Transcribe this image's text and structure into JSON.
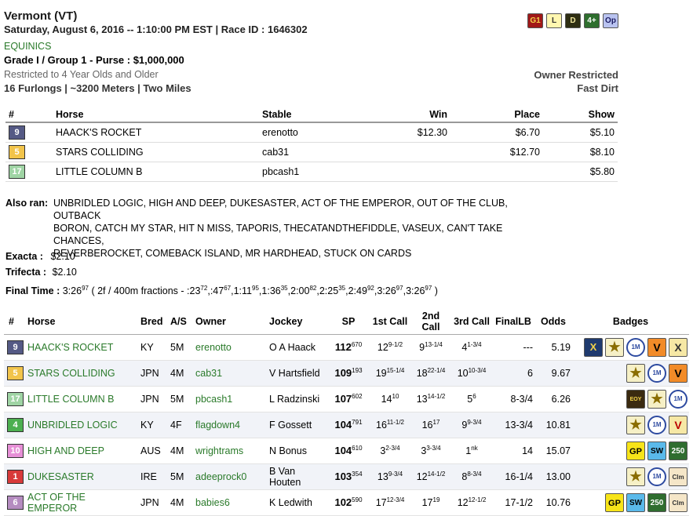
{
  "race": {
    "title": "Vermont (VT)",
    "datetime": "Saturday, August 6, 2016 -- 1:10:00 PM EST | Race ID : 1646302",
    "sponsor": "EQUINICS",
    "grade_purse": "Grade I / Group 1 - Purse : $1,000,000",
    "restriction": "Restricted to 4 Year Olds and Older",
    "distance": "16 Furlongs | ~3200 Meters | Two Miles",
    "owner_restriction": "Owner Restricted",
    "surface": "Fast Dirt",
    "top_badges": [
      {
        "label": "G1",
        "bg": "#a01818",
        "fg": "#f3d34a"
      },
      {
        "label": "L",
        "bg": "#fff7b0",
        "fg": "#333"
      },
      {
        "label": "D",
        "bg": "#2e2e12",
        "fg": "#f3e9a0"
      },
      {
        "label": "4+",
        "bg": "#2e6e2e",
        "fg": "#fff"
      },
      {
        "label": "Op",
        "bg": "#b9c3f0",
        "fg": "#1a1a60"
      }
    ]
  },
  "payout": {
    "headers": {
      "num": "#",
      "horse": "Horse",
      "stable": "Stable",
      "win": "Win",
      "place": "Place",
      "show": "Show"
    },
    "rows": [
      {
        "num": "9",
        "num_bg": "#555a85",
        "num_fg": "#fff",
        "horse": "HAACK'S ROCKET",
        "stable": "erenotto",
        "win": "$12.30",
        "place": "$6.70",
        "show": "$5.10"
      },
      {
        "num": "5",
        "num_bg": "#f2c44b",
        "num_fg": "#fff",
        "horse": "STARS COLLIDING",
        "stable": "cab31",
        "win": "",
        "place": "$12.70",
        "show": "$8.10"
      },
      {
        "num": "17",
        "num_bg": "#9fd4a4",
        "num_fg": "#fff",
        "horse": "LITTLE COLUMN B",
        "stable": "pbcash1",
        "win": "",
        "place": "",
        "show": "$5.80"
      }
    ]
  },
  "also_ran": {
    "label": "Also ran:",
    "lines": [
      "UNBRIDLED LOGIC, HIGH AND DEEP, DUKESASTER, ACT OF THE EMPEROR, OUT OF THE CLUB, OUTBACK",
      "BORON, CATCH MY STAR, HIT N MISS, TAPORIS, THECATANDTHEFIDDLE, VASEUX, CAN'T TAKE CHANCES,",
      "REVERBEROCKET, COMEBACK ISLAND, MR HARDHEAD, STUCK ON CARDS"
    ]
  },
  "exotics": {
    "exacta_label": "Exacta :",
    "exacta_value": "$2.10",
    "trifecta_label": "Trifecta :",
    "trifecta_value": "$2.10"
  },
  "final_time": {
    "label": "Final Time :",
    "value": "3:26",
    "value_sup": "97",
    "fractions_prefix": "( 2f / 400m fractions - :23",
    "fractions": [
      {
        "t": ":23",
        "s": "72"
      },
      {
        "t": ":47",
        "s": "67"
      },
      {
        "t": "1:11",
        "s": "95"
      },
      {
        "t": "1:36",
        "s": "35"
      },
      {
        "t": "2:00",
        "s": "82"
      },
      {
        "t": "2:25",
        "s": "35"
      },
      {
        "t": "2:49",
        "s": "92"
      },
      {
        "t": "3:26",
        "s": "97"
      },
      {
        "t": "3:26",
        "s": "97"
      }
    ]
  },
  "results": {
    "headers": {
      "num": "#",
      "horse": "Horse",
      "bred": "Bred",
      "as": "A/S",
      "owner": "Owner",
      "jockey": "Jockey",
      "sp": "SP",
      "call1": "1st Call",
      "call2": "2nd Call",
      "call3": "3rd Call",
      "finallb": "FinalLB",
      "odds": "Odds",
      "badges": "Badges"
    },
    "rows": [
      {
        "num": "9",
        "num_bg": "#555a85",
        "horse": "HAACK'S ROCKET",
        "bred": "KY",
        "as": "5M",
        "owner": "erenotto",
        "jockey": "O A Haack",
        "sp": "112",
        "sp_sup": "670",
        "c1": "12",
        "c1s": "9-1/2",
        "c2": "9",
        "c2s": "13-1/4",
        "c3": "4",
        "c3s": "1-3/4",
        "finallb": "---",
        "odds": "5.19",
        "badges": [
          "xb:X:x-badge",
          "star:★:star-badge",
          "circle:1M:mile-badge",
          "vo:V:v-badge",
          "x:X:x-badge"
        ]
      },
      {
        "num": "5",
        "num_bg": "#f2c44b",
        "horse": "STARS COLLIDING",
        "bred": "JPN",
        "as": "4M",
        "owner": "cab31",
        "jockey": "V Hartsfield",
        "sp": "109",
        "sp_sup": "193",
        "c1": "19",
        "c1s": "15-1/4",
        "c2": "18",
        "c2s": "22-1/4",
        "c3": "10",
        "c3s": "10-3/4",
        "finallb": "6",
        "odds": "9.67",
        "badges": [
          "star:★:star-badge",
          "circle:1M:mile-badge",
          "vo:V:v-badge"
        ]
      },
      {
        "num": "17",
        "num_bg": "#9fd4a4",
        "horse": "LITTLE COLUMN B",
        "bred": "JPN",
        "as": "5M",
        "owner": "pbcash1",
        "jockey": "L Radzinski",
        "sp": "107",
        "sp_sup": "602",
        "c1": "14",
        "c1s": "10",
        "c2": "13",
        "c2s": "14-1/2",
        "c3": "5",
        "c3s": "6",
        "finallb": "8-3/4",
        "odds": "6.26",
        "badges": [
          "eoy:EOY:eoy-badge",
          "star:★:star-badge",
          "circle:1M:mile-badge"
        ]
      },
      {
        "num": "4",
        "num_bg": "#4caf50",
        "horse": "UNBRIDLED LOGIC",
        "bred": "KY",
        "as": "4F",
        "owner": "flagdown4",
        "jockey": "F Gossett",
        "sp": "104",
        "sp_sup": "791",
        "c1": "16",
        "c1s": "11-1/2",
        "c2": "16",
        "c2s": "17",
        "c3": "9",
        "c3s": "9-3/4",
        "finallb": "13-3/4",
        "odds": "10.81",
        "badges": [
          "star:★:star-badge",
          "circle:1M:mile-badge",
          "v:V:v-badge"
        ]
      },
      {
        "num": "10",
        "num_bg": "#e68fd6",
        "horse": "HIGH AND DEEP",
        "bred": "AUS",
        "as": "4M",
        "owner": "wrightrams",
        "jockey": "N Bonus",
        "sp": "104",
        "sp_sup": "610",
        "c1": "3",
        "c1s": "2-3/4",
        "c2": "3",
        "c2s": "3-3/4",
        "c3": "1",
        "c3s": "nk",
        "finallb": "14",
        "odds": "15.07",
        "badges": [
          "gp:GP:gp-badge",
          "sw:SW:sw-badge",
          "n250:250:250-badge"
        ]
      },
      {
        "num": "1",
        "num_bg": "#d83a3a",
        "horse": "DUKESASTER",
        "bred": "IRE",
        "as": "5M",
        "owner": "adeeprock0",
        "jockey": "B Van Houten",
        "sp": "103",
        "sp_sup": "354",
        "c1": "13",
        "c1s": "9-3/4",
        "c2": "12",
        "c2s": "14-1/2",
        "c3": "8",
        "c3s": "8-3/4",
        "finallb": "16-1/4",
        "odds": "13.00",
        "badges": [
          "star:★:star-badge",
          "circle:1M:mile-badge",
          "clm:Clm:clm-badge"
        ]
      },
      {
        "num": "6",
        "num_bg": "#b58cc0",
        "horse": "ACT OF THE EMPEROR",
        "bred": "JPN",
        "as": "4M",
        "owner": "babies6",
        "jockey": "K Ledwith",
        "sp": "102",
        "sp_sup": "590",
        "c1": "17",
        "c1s": "12-3/4",
        "c2": "17",
        "c2s": "19",
        "c3": "12",
        "c3s": "12-1/2",
        "finallb": "17-1/2",
        "odds": "10.76",
        "badges": [
          "gp:GP:gp-badge",
          "sw:SW:sw-badge",
          "n250:250:250-badge",
          "clm:Clm:clm-badge"
        ]
      }
    ]
  }
}
